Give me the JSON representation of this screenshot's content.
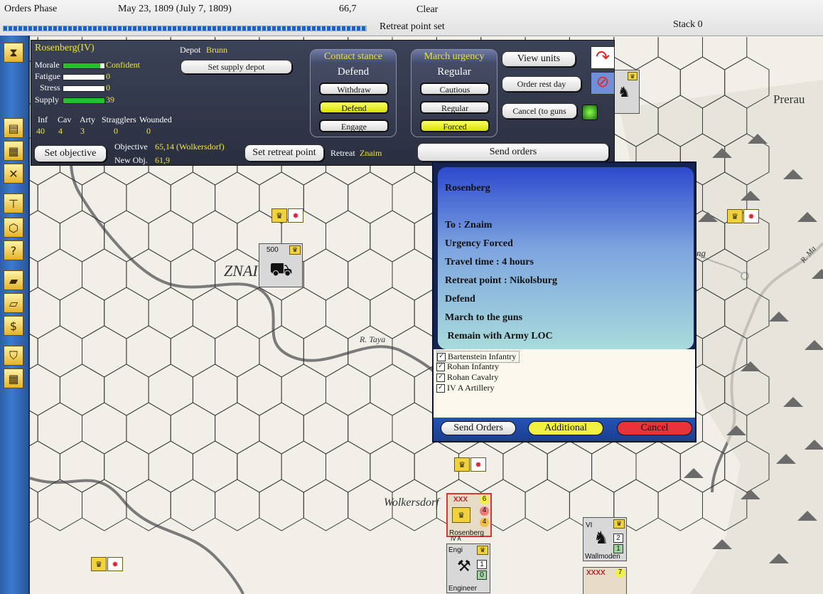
{
  "topbar": {
    "phase": "Orders Phase",
    "date": "May 23, 1809 (July 7, 1809)",
    "coords": "66,7",
    "weather": "Clear",
    "status": "Retreat point set",
    "stack": "Stack 0",
    "progress": 1.0
  },
  "toolbar": {
    "icons": [
      "hourglass-icon",
      "unit-list-icon",
      "supply-icon",
      "battle-icon",
      "org-chart-icon",
      "hex-icon",
      "help-icon",
      "reinforcement-icon",
      "road-icon",
      "money-icon",
      "shield-icon",
      "grid-icon"
    ]
  },
  "panel": {
    "unit_name": "Rosenberg(IV)",
    "depot_label": "Depot",
    "depot_value": "Brunn",
    "morale_label": "Morale",
    "morale_value": "Confident",
    "morale_level": 0.9,
    "fatigue_label": "Fatigue",
    "fatigue_value": "0",
    "stress_label": "Stress",
    "stress_value": "0",
    "supply_label": "Supply",
    "supply_value": "39",
    "supply_level": 1.0,
    "cols": [
      "Inf",
      "Cav",
      "Arty",
      "Stragglers",
      "Wounded"
    ],
    "vals": [
      "40",
      "4",
      "3",
      "0",
      "0"
    ],
    "set_supply_depot": "Set supply depot",
    "set_objective": "Set objective",
    "objective_label": "Objective",
    "objective_value": "65,14 (Wolkersdorf)",
    "new_obj_label": "New Obj.",
    "new_obj_value": "61,9",
    "set_retreat_point": "Set retreat point",
    "retreat_label": "Retreat",
    "retreat_value": "Znaim",
    "contact_title": "Contact stance",
    "contact_value": "Defend",
    "contact_options": [
      "Withdraw",
      "Defend",
      "Engage"
    ],
    "march_title": "March urgency",
    "march_value": "Regular",
    "march_options": [
      "Cautious",
      "Regular",
      "Forced"
    ],
    "view_units": "View units",
    "order_rest_day": "Order rest day",
    "cancel_to_guns": "Cancel (to guns",
    "send_orders": "Send orders"
  },
  "dialog": {
    "lines": [
      "Rosenberg",
      "To : Znaim",
      "Urgency Forced",
      "Travel time :  4 hours",
      "Retreat point : Nikolsburg",
      "Defend",
      "March to the guns",
      " Remain with Army LOC"
    ],
    "units": [
      "Bartenstein Infantry",
      "Rohan Infantry",
      "Rohan Cavalry",
      "IV A Artillery"
    ],
    "send_orders": "Send Orders",
    "additional": "Additional",
    "cancel": "Cancel",
    "colors": {
      "additional": "#f2f040",
      "cancel": "#e8333a"
    }
  },
  "map": {
    "labels": {
      "znaim": "ZNAI",
      "prerau": "Prerau",
      "taya": "R. Taya",
      "wolkersdorf": "Wolkersdorf",
      "ng": "ng",
      "march": "R. Ma"
    },
    "counters": {
      "depot_value": "500",
      "rosenberg_name": "Rosenberg",
      "rosenberg_size": "XXX",
      "rosenberg_stats": [
        "6",
        "4",
        "4"
      ],
      "wallmoden_name": "Wallmoden",
      "wallmoden_corps": "VI",
      "wallmoden_stats": [
        "2",
        "1"
      ],
      "engineer_name": "Engineer",
      "engineer_abbr": "Engi",
      "engineer_stats": [
        "1",
        "0"
      ],
      "army_size": "XXXX",
      "army_stats": [
        "7"
      ],
      "under_label": "IV A"
    }
  }
}
